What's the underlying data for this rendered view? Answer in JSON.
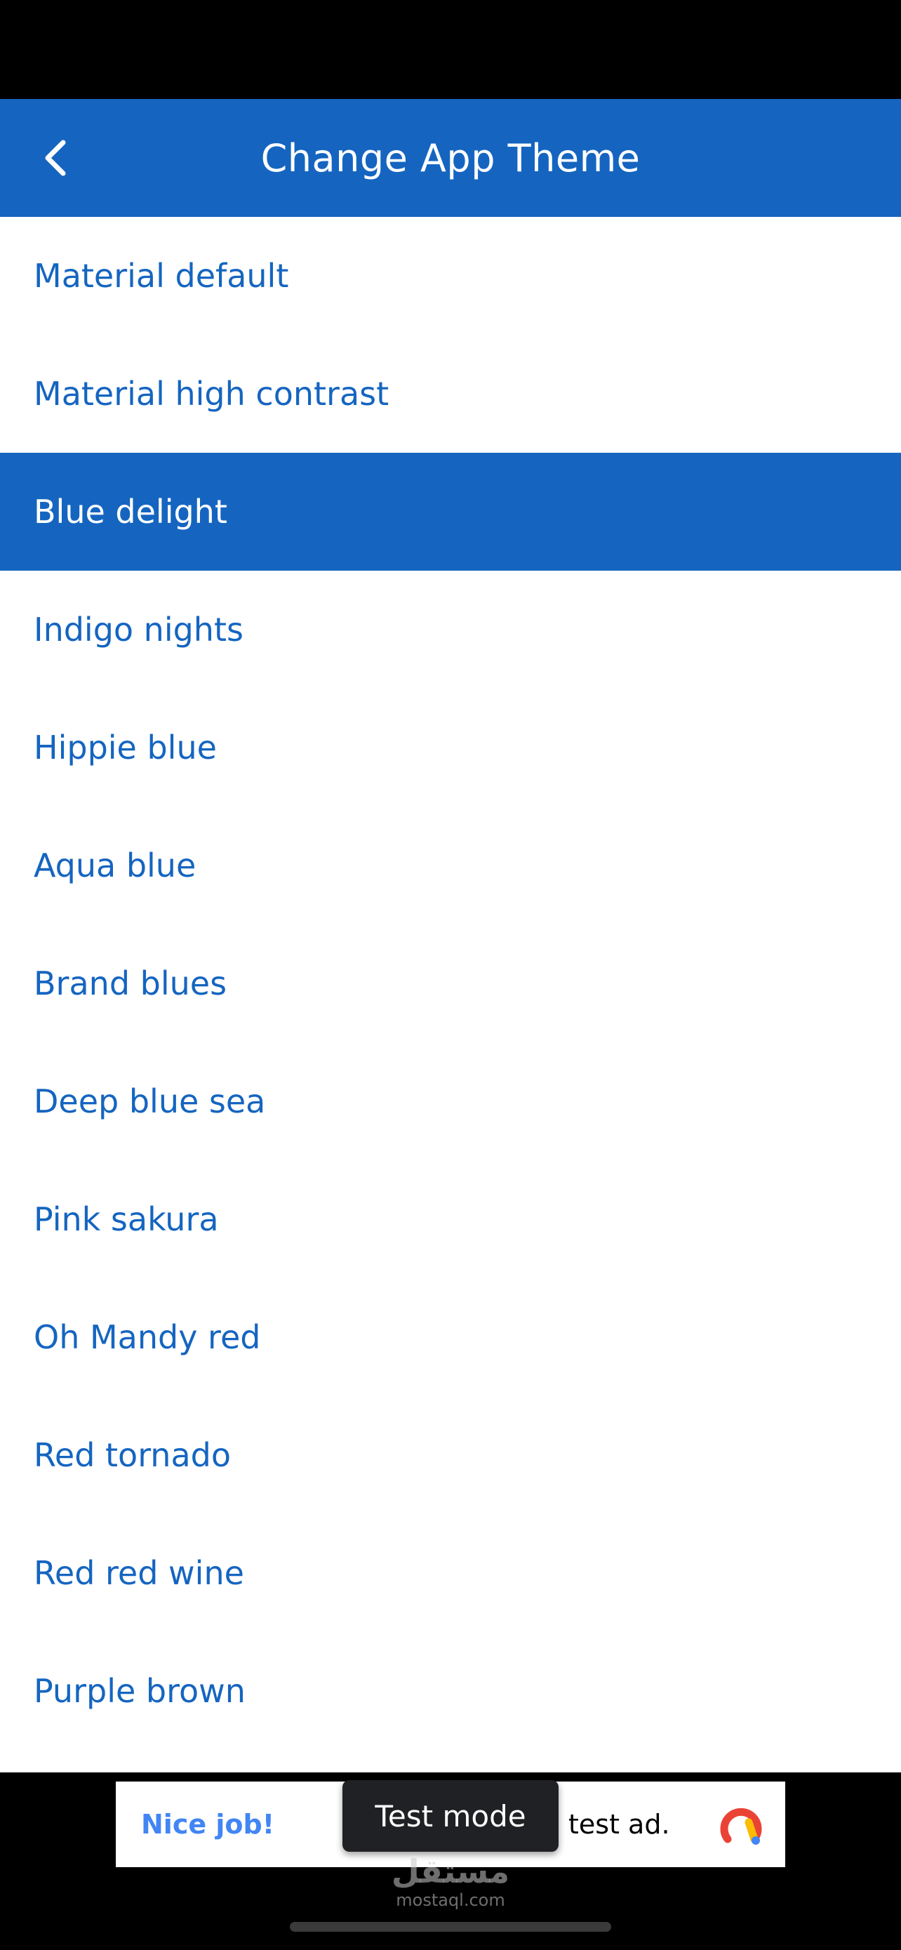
{
  "app_bar": {
    "title": "Change App Theme",
    "back_icon": "chevron-left-icon",
    "color": "#1565c0"
  },
  "themes": [
    {
      "label": "Material default",
      "selected": false
    },
    {
      "label": "Material high contrast",
      "selected": false
    },
    {
      "label": "Blue delight",
      "selected": true
    },
    {
      "label": "Indigo nights",
      "selected": false
    },
    {
      "label": "Hippie blue",
      "selected": false
    },
    {
      "label": "Aqua blue",
      "selected": false
    },
    {
      "label": "Brand blues",
      "selected": false
    },
    {
      "label": "Deep blue sea",
      "selected": false
    },
    {
      "label": "Pink sakura",
      "selected": false
    },
    {
      "label": "Oh Mandy red",
      "selected": false
    },
    {
      "label": "Red tornado",
      "selected": false
    },
    {
      "label": "Red red wine",
      "selected": false
    },
    {
      "label": "Purple brown",
      "selected": false
    }
  ],
  "ad": {
    "nice_job": "Nice job!",
    "tail_text": "test ad.",
    "test_mode": "Test mode",
    "logo_icon": "adsense-logo-icon"
  },
  "watermark": {
    "arabic": "مستقل",
    "latin": "mostaql.com"
  },
  "colors": {
    "accent": "#1565c0",
    "ad_link": "#4285f4"
  }
}
